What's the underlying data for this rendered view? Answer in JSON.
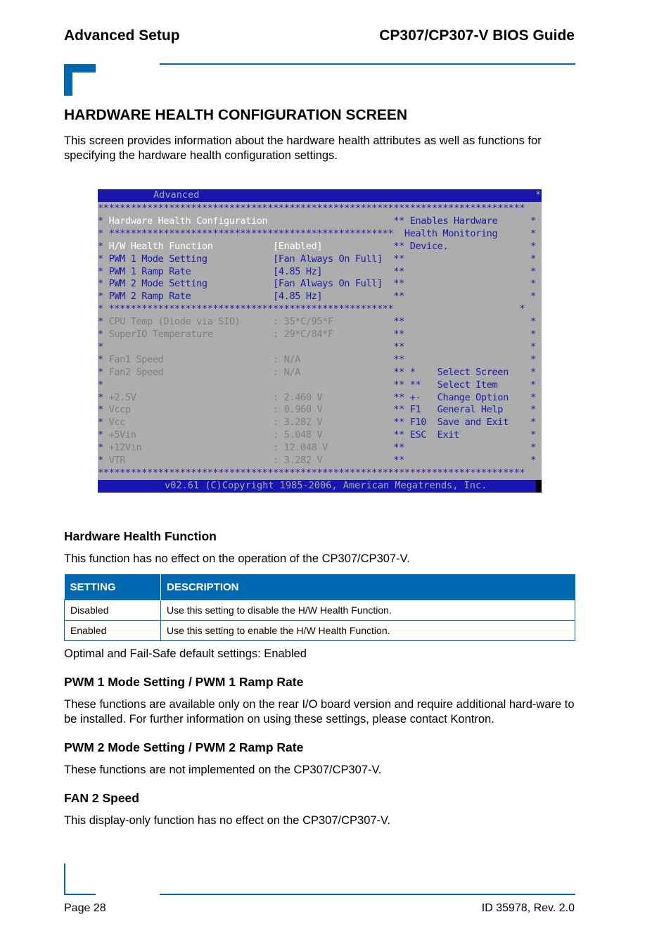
{
  "header": {
    "section_title": "Advanced Setup",
    "doc_title": "CP307/CP307-V BIOS Guide"
  },
  "main": {
    "heading": "HARDWARE HEALTH CONFIGURATION SCREEN",
    "intro": "This screen provides information about the hardware health attributes as well as functions for specifying the hardware health configuration settings.",
    "bios_screen": {
      "active_tab": "Advanced",
      "title": "Hardware Health Configuration",
      "settings": [
        {
          "label": "H/W Health Function",
          "value": "[Enabled]",
          "selected": true
        },
        {
          "label": "PWM 1 Mode Setting",
          "value": "[Fan Always On Full]"
        },
        {
          "label": "PWM 1 Ramp Rate",
          "value": "[4.85 Hz]"
        },
        {
          "label": "PWM 2 Mode Setting",
          "value": "[Fan Always On Full]"
        },
        {
          "label": "PWM 2 Ramp Rate",
          "value": "[4.85 Hz]"
        }
      ],
      "readings": [
        {
          "label": "CPU Temp (Diode via SIO)",
          "value": ": 35*C/95*F"
        },
        {
          "label": "SuperIO Temperature",
          "value": ": 29*C/84*F"
        },
        {
          "label": "Fan1 Speed",
          "value": ": N/A"
        },
        {
          "label": "Fan2 Speed",
          "value": ": N/A"
        },
        {
          "label": "+2.5V",
          "value": ": 2.460 V"
        },
        {
          "label": "Vccp",
          "value": ": 0.960 V"
        },
        {
          "label": "Vcc",
          "value": ": 3.282 V"
        },
        {
          "label": "+5Vin",
          "value": ": 5.048 V"
        },
        {
          "label": "+12Vin",
          "value": ": 12.048 V"
        },
        {
          "label": "VTR",
          "value": ": 3.282 V"
        }
      ],
      "help_text": [
        "Enables Hardware",
        "Health Monitoring",
        "Device."
      ],
      "keys": [
        {
          "key": "*",
          "action": "Select Screen"
        },
        {
          "key": "**",
          "action": "Select Item"
        },
        {
          "key": "+-",
          "action": "Change Option"
        },
        {
          "key": "F1",
          "action": "General Help"
        },
        {
          "key": "F10",
          "action": "Save and Exit"
        },
        {
          "key": "ESC",
          "action": "Exit"
        }
      ],
      "copyright": "v02.61 (C)Copyright 1985-2006, American Megatrends, Inc."
    },
    "hw_health": {
      "heading": "Hardware Health Function",
      "text": "This function has no effect on the operation of the CP307/CP307-V.",
      "table": {
        "headers": [
          "SETTING",
          "DESCRIPTION"
        ],
        "rows": [
          [
            "Disabled",
            "Use this setting to disable the H/W Health Function."
          ],
          [
            "Enabled",
            "Use this setting to enable the H/W Health Function."
          ]
        ]
      },
      "defaults": "Optimal and Fail-Safe default settings: Enabled"
    },
    "pwm1": {
      "heading": "PWM 1 Mode Setting / PWM 1 Ramp Rate",
      "text": "These functions are available only on the rear I/O board version and require additional hard-ware to be installed. For further information on using these settings, please contact Kontron."
    },
    "pwm2": {
      "heading": "PWM 2 Mode Setting / PWM 2 Ramp Rate",
      "text": "These functions are not implemented on the CP307/CP307-V."
    },
    "fan2": {
      "heading": "FAN 2 Speed",
      "text": "This display-only function has no effect on the CP307/CP307-V."
    }
  },
  "footer": {
    "page": "Page 28",
    "doc_id": "ID 35978, Rev. 2.0"
  }
}
